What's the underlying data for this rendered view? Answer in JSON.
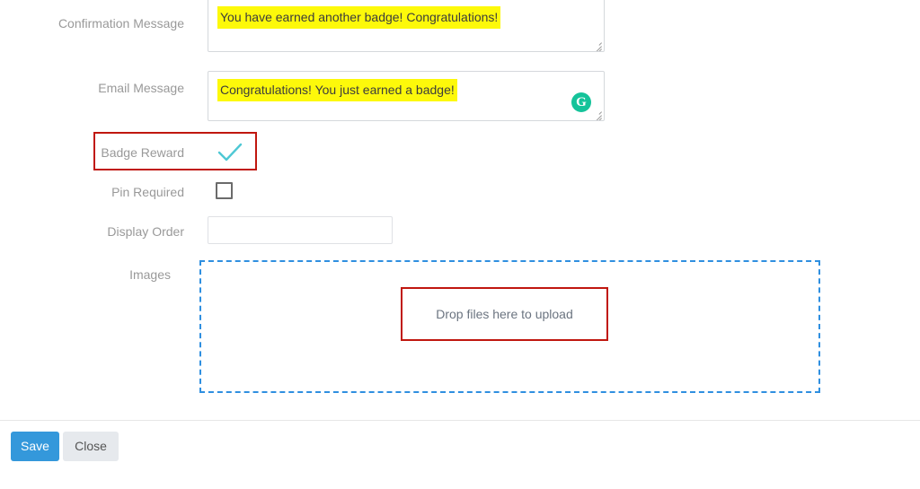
{
  "form": {
    "fields": [
      {
        "id": "confirmation-message",
        "label": "Confirmation Message",
        "type": "textarea",
        "value": "You have earned another badge! Congratulations!",
        "highlighted": true
      },
      {
        "id": "email-message",
        "label": "Email Message",
        "type": "textarea",
        "value": "Congratulations! You just earned a badge!",
        "highlighted": true
      },
      {
        "id": "badge-reward",
        "label": "Badge Reward",
        "type": "checkbox",
        "checked": true,
        "annotated": true
      },
      {
        "id": "pin-required",
        "label": "Pin Required",
        "type": "checkbox",
        "checked": false,
        "annotated": false
      },
      {
        "id": "display-order",
        "label": "Display Order",
        "type": "text",
        "value": "",
        "placeholder": ""
      },
      {
        "id": "images",
        "label": "Images",
        "type": "dropzone",
        "drop_text": "Drop files here to upload",
        "annotated": true
      }
    ]
  },
  "editor_badge": {
    "name": "grammarly-icon",
    "glyph": "G"
  },
  "footer": {
    "save_label": "Save",
    "close_label": "Close"
  },
  "colors": {
    "highlight": "#fdf90a",
    "annotation_red": "#c0170f",
    "dropzone_blue": "#2f8fe0",
    "check_teal": "#4ec8d4",
    "primary_button": "#3498db",
    "default_button": "#e6e9ed",
    "label_gray": "#999999",
    "grammarly_green": "#15c39a"
  }
}
